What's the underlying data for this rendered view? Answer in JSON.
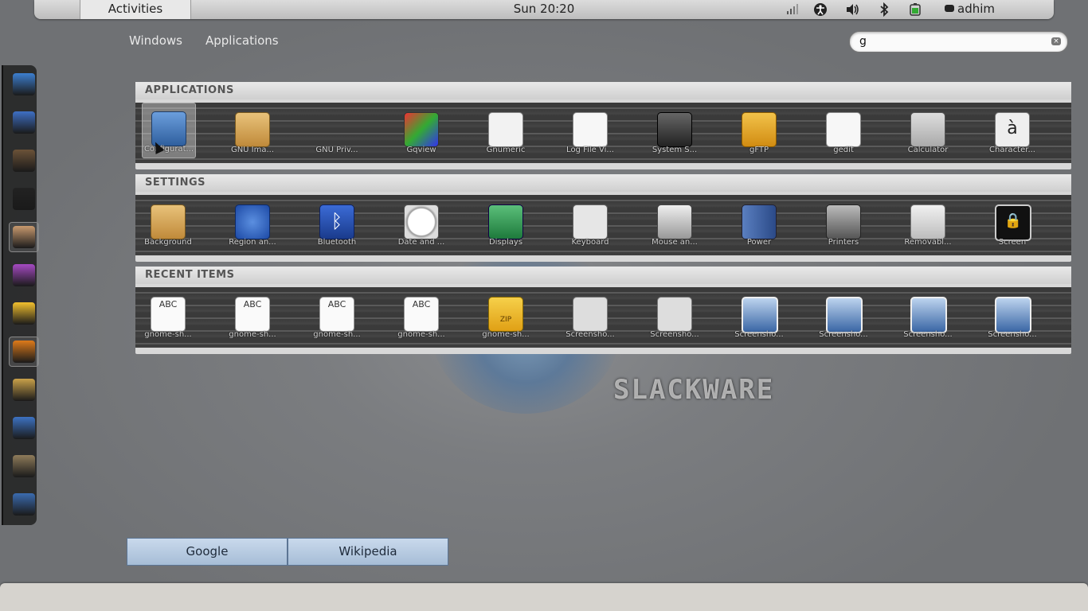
{
  "topbar": {
    "activities": "Activities",
    "clock": "Sun 20:20",
    "user": "adhim"
  },
  "view": {
    "windows": "Windows",
    "applications": "Applications"
  },
  "search": {
    "value": "g"
  },
  "dash": {
    "items": [
      {
        "name": "compiz-config",
        "color": "#3d7fd0"
      },
      {
        "name": "gimp-footprint",
        "color": "#3e6fc4"
      },
      {
        "name": "speaker",
        "color": "#6b5238"
      },
      {
        "name": "terminal",
        "color": "#222222"
      },
      {
        "name": "nautilus-shell",
        "color": "#c89a6e"
      },
      {
        "name": "empathy",
        "color": "#a54ac2"
      },
      {
        "name": "cheese",
        "color": "#f2c02e"
      },
      {
        "name": "cheese-camera",
        "color": "#dd7a1a"
      },
      {
        "name": "gnu-image-manipulation",
        "color": "#c9a14a"
      },
      {
        "name": "configuration-tool",
        "color": "#3d72c2"
      },
      {
        "name": "screensaver",
        "color": "#8e7b5a"
      },
      {
        "name": "thunderbird",
        "color": "#3b6bb0"
      }
    ]
  },
  "sections": {
    "applications": {
      "header": "APPLICATIONS",
      "items": [
        {
          "label": "Configurat...",
          "icon": "blue"
        },
        {
          "label": "GNU Ima...",
          "icon": "paint"
        },
        {
          "label": "GNU Priv...",
          "icon": "keys"
        },
        {
          "label": "Gqview",
          "icon": "gqview"
        },
        {
          "label": "Gnumeric",
          "icon": "chart"
        },
        {
          "label": "Log File Vi...",
          "icon": "doc"
        },
        {
          "label": "System S...",
          "icon": "dark"
        },
        {
          "label": "gFTP",
          "icon": "cabinet"
        },
        {
          "label": "gedit",
          "icon": "doc"
        },
        {
          "label": "Calculator",
          "icon": "calc"
        },
        {
          "label": "Character...",
          "icon": "char",
          "glyph": "à"
        }
      ]
    },
    "settings": {
      "header": "SETTINGS",
      "items": [
        {
          "label": "Background",
          "icon": "paint"
        },
        {
          "label": "Region an...",
          "icon": "globe"
        },
        {
          "label": "Bluetooth",
          "icon": "bt",
          "glyph": "ᛒ"
        },
        {
          "label": "Date and ...",
          "icon": "clock"
        },
        {
          "label": "Displays",
          "icon": "display"
        },
        {
          "label": "Keyboard",
          "icon": "kbd"
        },
        {
          "label": "Mouse an...",
          "icon": "mouse"
        },
        {
          "label": "Power",
          "icon": "power"
        },
        {
          "label": "Printers",
          "icon": "printer"
        },
        {
          "label": "Removabl...",
          "icon": "disk"
        },
        {
          "label": "Screen",
          "icon": "lock",
          "glyph": "🔒"
        }
      ]
    },
    "recent": {
      "header": "RECENT ITEMS",
      "items": [
        {
          "label": "gnome-sh...",
          "icon": "abc",
          "glyph": "ABC"
        },
        {
          "label": "gnome-sh...",
          "icon": "abc",
          "glyph": "ABC"
        },
        {
          "label": "gnome-sh...",
          "icon": "abc",
          "glyph": "ABC"
        },
        {
          "label": "gnome-sh...",
          "icon": "abc",
          "glyph": "ABC"
        },
        {
          "label": "gnome-sh...",
          "icon": "zip",
          "glyph": "ZIP"
        },
        {
          "label": "Screensho...",
          "icon": "shot"
        },
        {
          "label": "Screensho...",
          "icon": "shot"
        },
        {
          "label": "Screensho...",
          "icon": "img"
        },
        {
          "label": "Screensho...",
          "icon": "img"
        },
        {
          "label": "Screensho...",
          "icon": "img"
        },
        {
          "label": "Screensho...",
          "icon": "img"
        }
      ]
    }
  },
  "providers": {
    "google": "Google",
    "wikipedia": "Wikipedia"
  },
  "wallpaper": {
    "brand": "SLACKWARE"
  }
}
